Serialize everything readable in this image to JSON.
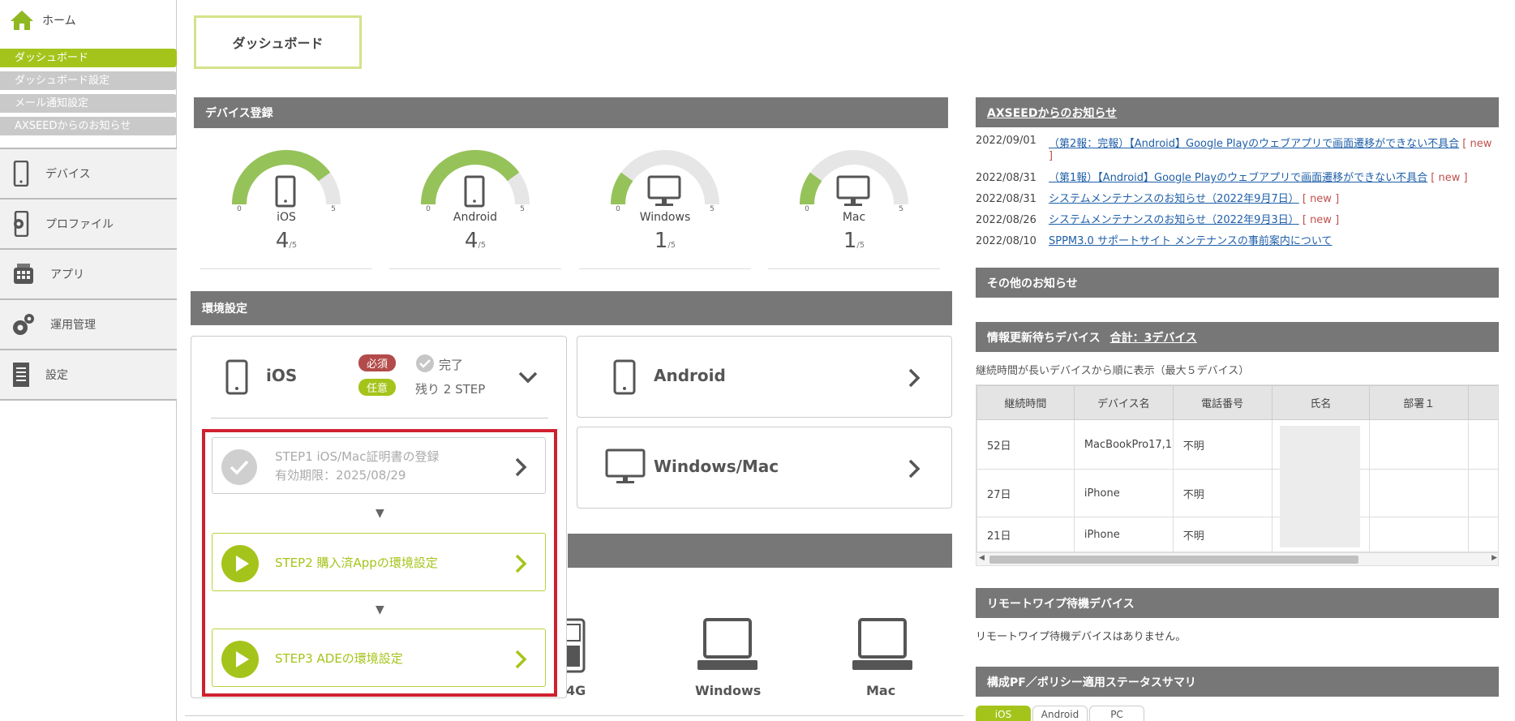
{
  "sidebar": {
    "home": "ホーム",
    "submenu": [
      "ダッシュボード",
      "ダッシュボード設定",
      "メール通知設定",
      "AXSEEDからのお知らせ"
    ],
    "nav": [
      "デバイス",
      "プロファイル",
      "アプリ",
      "運用管理",
      "設定"
    ]
  },
  "page_title": "ダッシュボード",
  "device_registration": {
    "header": "デバイス登録",
    "gauges": [
      {
        "name": "iOS",
        "value": "4",
        "max": "/5",
        "min_label": "0",
        "max_label": "5",
        "fraction": 0.8
      },
      {
        "name": "Android",
        "value": "4",
        "max": "/5",
        "min_label": "0",
        "max_label": "5",
        "fraction": 0.8
      },
      {
        "name": "Windows",
        "value": "1",
        "max": "/5",
        "min_label": "0",
        "max_label": "5",
        "fraction": 0.2
      },
      {
        "name": "Mac",
        "value": "1",
        "max": "/5",
        "min_label": "0",
        "max_label": "5",
        "fraction": 0.2
      }
    ]
  },
  "env_setup": {
    "header": "環境設定",
    "ios": {
      "label": "iOS",
      "required": "必須",
      "done": "完了",
      "optional": "任意",
      "remaining": "残り 2 STEP"
    },
    "android": {
      "label": "Android"
    },
    "winmac": {
      "label": "Windows/Mac"
    },
    "steps": [
      {
        "title": "STEP1 iOS/Mac証明書の登録",
        "sub": "有効期限：2025/08/29"
      },
      {
        "title": "STEP2 購入済Appの環境設定"
      },
      {
        "title": "STEP3 ADEの環境設定"
      }
    ],
    "bottom_labels": [
      "4G",
      "Windows",
      "Mac"
    ]
  },
  "news": {
    "header": "AXSEEDからのお知らせ",
    "items": [
      {
        "date": "2022/09/01",
        "text": "（第2報：完報）【Android】Google Playのウェブアプリで画面遷移ができない不具合",
        "new": "[ new ]"
      },
      {
        "date": "2022/08/31",
        "text": "（第1報）【Android】Google Playのウェブアプリで画面遷移ができない不具合",
        "new": "[ new ]"
      },
      {
        "date": "2022/08/31",
        "text": "システムメンテナンスのお知らせ（2022年9月7日）",
        "new": "[ new ]"
      },
      {
        "date": "2022/08/26",
        "text": "システムメンテナンスのお知らせ（2022年9月3日）",
        "new": "[ new ]"
      },
      {
        "date": "2022/08/10",
        "text": "SPPM3.0 サポートサイト メンテナンスの事前案内について",
        "new": ""
      }
    ]
  },
  "other_news": {
    "header": "その他のお知らせ"
  },
  "pending_devices": {
    "header": "情報更新待ちデバイス",
    "total": "合計：3デバイス",
    "note": "継続時間が長いデバイスから順に表示（最大５デバイス）",
    "columns": [
      "継続時間",
      "デバイス名",
      "電話番号",
      "氏名",
      "部署１"
    ],
    "rows": [
      [
        "52日",
        "MacBookPro17,1",
        "不明",
        "",
        ""
      ],
      [
        "27日",
        "iPhone",
        "不明",
        "",
        ""
      ],
      [
        "21日",
        "iPhone",
        "不明",
        "",
        ""
      ]
    ]
  },
  "remote_wipe": {
    "header": "リモートワイプ待機デバイス",
    "message": "リモートワイプ待機デバイスはありません。"
  },
  "policy": {
    "header": "構成PF／ポリシー適用ステータスサマリ",
    "tabs": [
      "iOS",
      "Android",
      "PC"
    ]
  },
  "colors": {
    "accent": "#a5c41b",
    "header_gray": "#777777",
    "highlight_red": "#d0202f",
    "link": "#1f5fa8"
  }
}
